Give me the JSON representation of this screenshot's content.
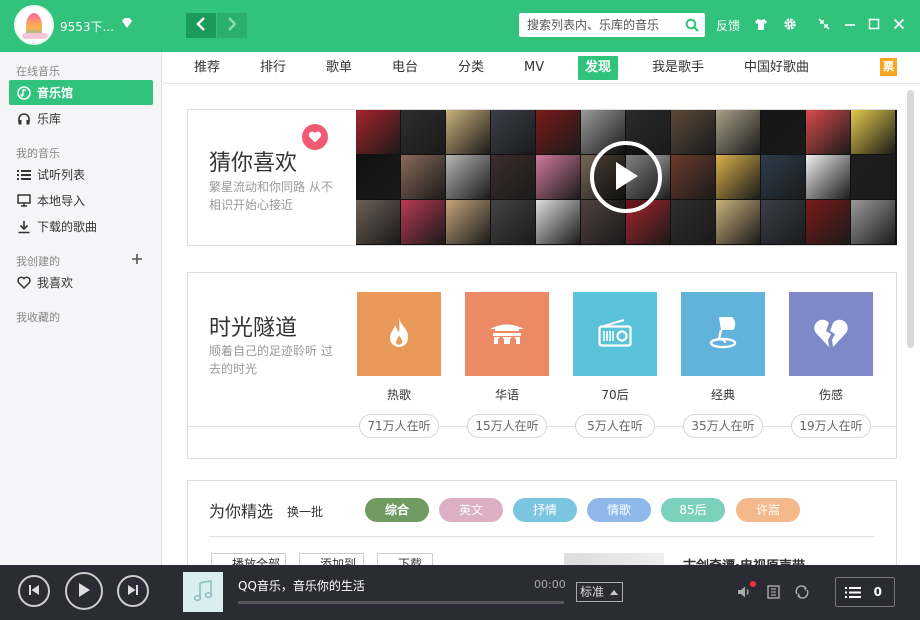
{
  "app": {
    "name": "QQ音乐"
  },
  "user": {
    "name": "9553下..."
  },
  "search": {
    "placeholder": "搜索列表内、乐库的音乐"
  },
  "header": {
    "feedback_label": "反馈"
  },
  "sidebar": {
    "section_online": "在线音乐",
    "section_mine": "我的音乐",
    "section_created": "我创建的",
    "section_collected": "我收藏的",
    "items": [
      {
        "label": "音乐馆",
        "icon": "music-hall-icon",
        "active": true
      },
      {
        "label": "乐库",
        "icon": "headphone-icon"
      },
      {
        "label": "试听列表",
        "icon": "list-icon"
      },
      {
        "label": "本地导入",
        "icon": "monitor-icon"
      },
      {
        "label": "下载的歌曲",
        "icon": "download-icon"
      },
      {
        "label": "我喜欢",
        "icon": "heart-icon"
      }
    ]
  },
  "tabs": [
    {
      "label": "推荐"
    },
    {
      "label": "排行"
    },
    {
      "label": "歌单"
    },
    {
      "label": "电台"
    },
    {
      "label": "分类"
    },
    {
      "label": "MV"
    },
    {
      "label": "发现",
      "active": true
    },
    {
      "label": "我是歌手"
    },
    {
      "label": "中国好歌曲"
    }
  ],
  "ticket_label": "票",
  "guess": {
    "title": "猜你喜欢",
    "subtitle": "繁星流动和你同路 从不相识开始心接近",
    "mosaic_colors": [
      "#a8242c",
      "#2e2e2e",
      "#c9b17a",
      "#3b3f4a",
      "#7a1a1a",
      "#9a9a9a",
      "#2a2a2a",
      "#5d4a3a",
      "#aa9f88",
      "#151515",
      "#d94b4b",
      "#e3c94b",
      "#111111",
      "#8b6a5a",
      "#b5b5b5",
      "#3d2d2d",
      "#d07a9a",
      "#776655",
      "#c7c7c7",
      "#6c3b2c",
      "#d9b04a",
      "#2d3d4d",
      "#efefef",
      "#1f1f1f",
      "#6b5f55",
      "#b83a52",
      "#c4a57a",
      "#444444",
      "#dddddd",
      "#514040"
    ]
  },
  "tunnel": {
    "title": "时光隧道",
    "subtitle": "顺着自己的足迹聆听 过去的时光",
    "categories": [
      {
        "label": "热歌",
        "listeners": "71万人在听",
        "color": "#e99a58",
        "icon": "flame-icon"
      },
      {
        "label": "华语",
        "listeners": "15万人在听",
        "color": "#ec8a66",
        "icon": "pavilion-icon"
      },
      {
        "label": "70后",
        "listeners": "5万人在听",
        "color": "#5ac2d9",
        "icon": "radio-icon"
      },
      {
        "label": "经典",
        "listeners": "35万人在听",
        "color": "#62b3db",
        "icon": "gramophone-icon"
      },
      {
        "label": "伤感",
        "listeners": "19万人在听",
        "color": "#7f88c9",
        "icon": "broken-heart-icon"
      }
    ]
  },
  "picks": {
    "title": "为你精选",
    "refresh_label": "换一批",
    "filters": [
      {
        "label": "综合",
        "color": "#6f9b63",
        "active": true
      },
      {
        "label": "英文",
        "color": "#dcb0c2"
      },
      {
        "label": "抒情",
        "color": "#7cc5e0"
      },
      {
        "label": "情歌",
        "color": "#8fb8ea"
      },
      {
        "label": "85后",
        "color": "#7cd1bd"
      },
      {
        "label": "许嵩",
        "color": "#f3b98a"
      }
    ],
    "actions": [
      {
        "label": "播放全部"
      },
      {
        "label": "添加到"
      },
      {
        "label": "下载"
      }
    ],
    "peek_title": "古剑奇谭·电视原声带"
  },
  "player": {
    "title": "QQ音乐，音乐你的生活",
    "time": "00:00",
    "quality_label": "标准",
    "playlist_count": "0",
    "progress": 0
  }
}
